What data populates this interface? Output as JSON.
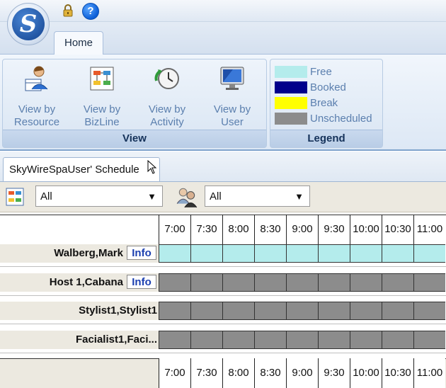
{
  "app": {
    "logo_letter": "S",
    "home_tab": "Home"
  },
  "ribbon": {
    "view_group": {
      "label": "View",
      "buttons": [
        {
          "line1": "View by",
          "line2": "Resource",
          "icon": "resource-calendar-icon"
        },
        {
          "line1": "View by",
          "line2": "BizLine",
          "icon": "bizline-chart-icon"
        },
        {
          "line1": "View by",
          "line2": "Activity",
          "icon": "activity-clock-icon"
        },
        {
          "line1": "View by",
          "line2": "User",
          "icon": "user-monitor-icon"
        }
      ]
    },
    "legend_group": {
      "label": "Legend",
      "items": [
        {
          "label": "Free",
          "color": "#b4ecec"
        },
        {
          "label": "Booked",
          "color": "#00008b"
        },
        {
          "label": "Break",
          "color": "#ffff00"
        },
        {
          "label": "Unscheduled",
          "color": "#8c8c8c"
        }
      ]
    }
  },
  "schedule_tab": {
    "label": "SkyWireSpaUser' Schedule"
  },
  "filters": {
    "bizline": {
      "value": "All",
      "icon": "bizline-filter-icon"
    },
    "user": {
      "value": "All",
      "icon": "users-filter-icon"
    }
  },
  "grid": {
    "times": [
      "7:00",
      "7:30",
      "8:00",
      "8:30",
      "9:00",
      "9:30",
      "10:00",
      "10:30",
      "11:00"
    ],
    "rows": [
      {
        "name": "Walberg,Mark",
        "info": "Info",
        "status": "Free"
      },
      {
        "name": "Host 1,Cabana",
        "info": "Info",
        "status": "Unscheduled"
      },
      {
        "name": "Stylist1,Stylist1",
        "info": "",
        "status": "Unscheduled"
      },
      {
        "name": "Facialist1,Faci...",
        "info": "",
        "status": "Unscheduled"
      }
    ]
  }
}
